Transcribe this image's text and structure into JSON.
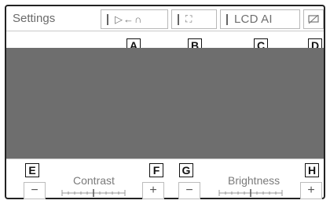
{
  "header": {
    "title": "Settings",
    "buttons": [
      {
        "id": "A",
        "icon": "video-to-audio-icon",
        "glyph": "▷←∩"
      },
      {
        "id": "B",
        "icon": "screen-size-icon",
        "glyph": "⛶"
      },
      {
        "id": "C",
        "label": "LCD AI"
      },
      {
        "id": "D",
        "icon": "screen-off-icon"
      }
    ]
  },
  "adjust": {
    "contrast": {
      "label": "Contrast",
      "minus": "−",
      "plus": "+",
      "level": 0.5
    },
    "brightness": {
      "label": "Brightness",
      "minus": "−",
      "plus": "+",
      "level": 0.5
    }
  },
  "callouts": [
    "A",
    "B",
    "C",
    "D",
    "E",
    "F",
    "G",
    "H"
  ],
  "colors": {
    "preview": "#6e6e6e",
    "border": "#222222",
    "text": "#707070"
  }
}
